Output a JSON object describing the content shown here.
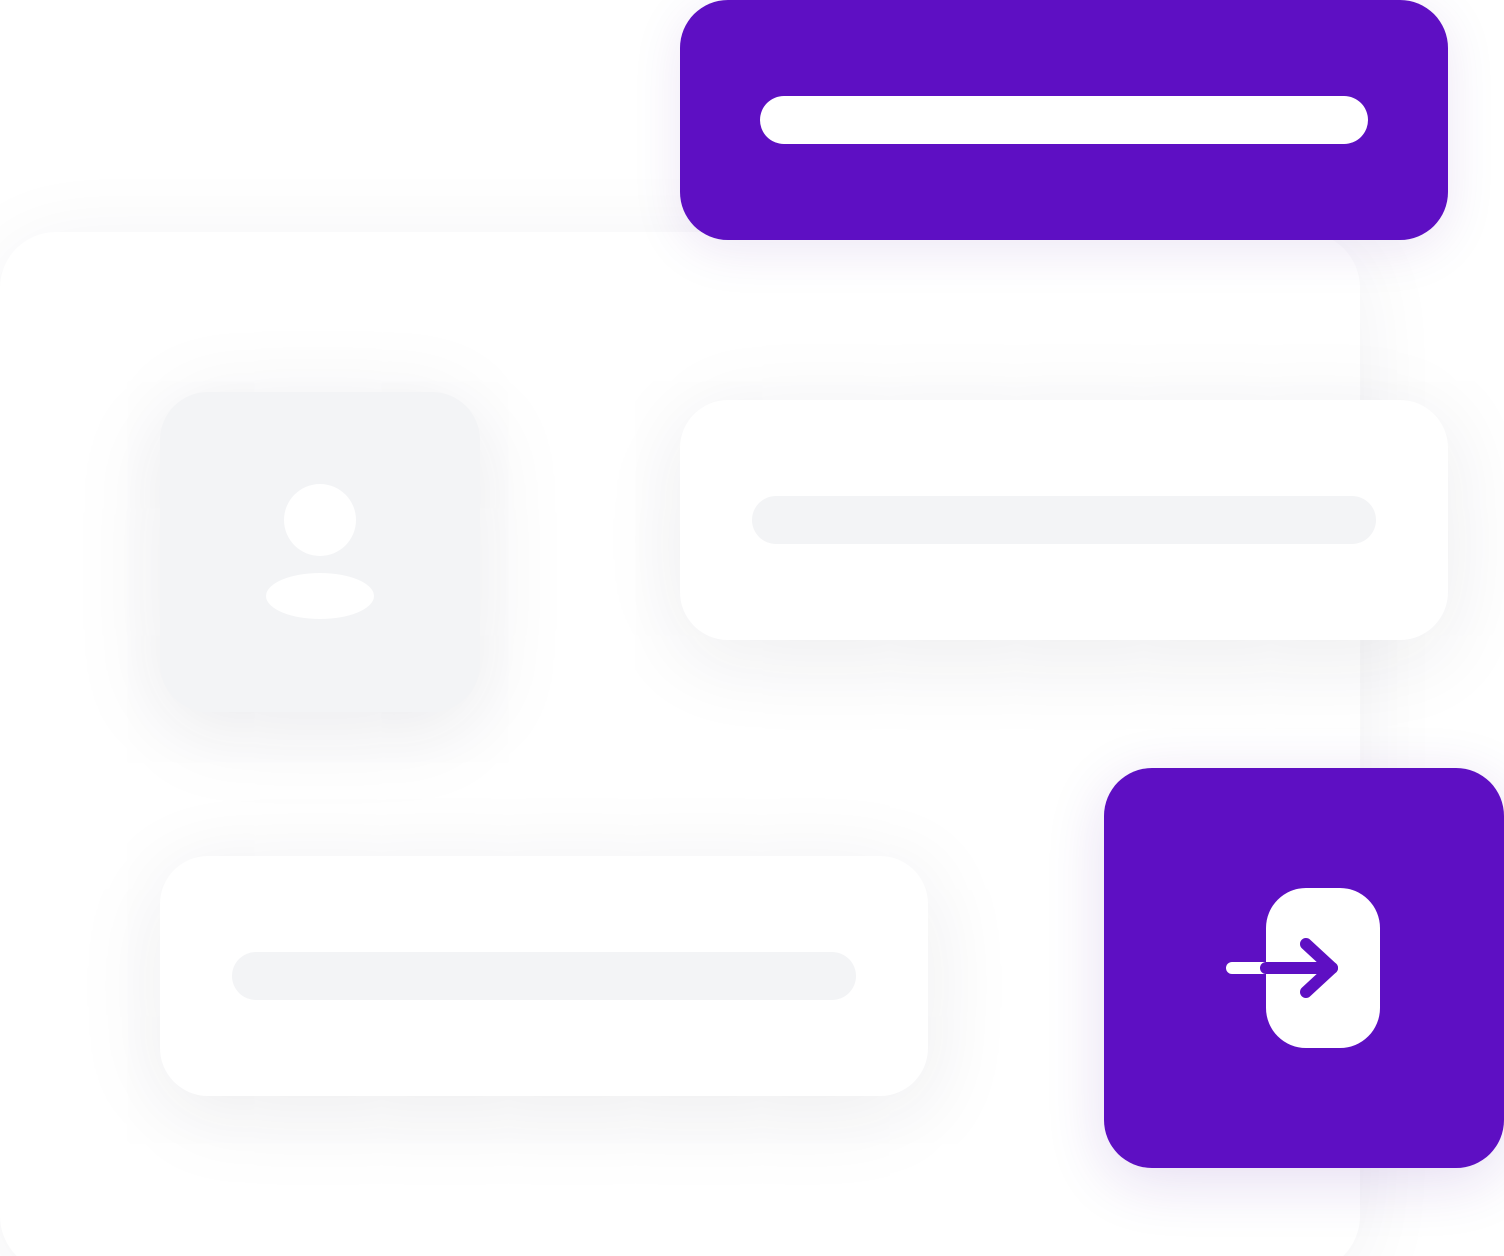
{
  "theme": {
    "accent": "#5e0fc3",
    "surface": "#ffffff",
    "field_fill": "#f3f4f6"
  },
  "header": {
    "title_bar_text": ""
  },
  "profile": {
    "avatar_icon": "user-icon"
  },
  "form": {
    "fields": [
      {
        "value": "",
        "placeholder": ""
      },
      {
        "value": "",
        "placeholder": ""
      }
    ]
  },
  "action": {
    "icon": "sign-in-icon"
  }
}
